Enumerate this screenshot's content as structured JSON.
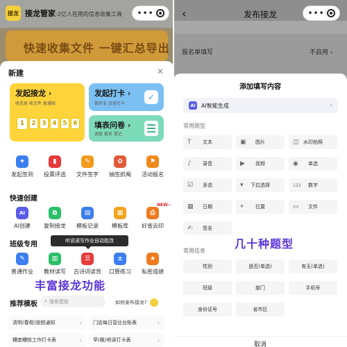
{
  "left": {
    "app_logo": "接龙",
    "app_title": "接龙管家",
    "app_subtitle": "-2亿人在用的信息收集工具",
    "banner_text": "快速收集文件  一键汇总导出",
    "sheet_title": "新建",
    "close_icon": "close-icon",
    "cards": {
      "relay": {
        "title": "发起接龙",
        "sub": "收信息 收文件 发通知",
        "nums": [
          "1",
          "2",
          "3",
          "4",
          "5",
          "6"
        ]
      },
      "checkin": {
        "title": "发起打卡",
        "sub": "做作业 日常打卡"
      },
      "form": {
        "title": "填表问卷",
        "sub": "调查 报名 登记"
      }
    },
    "row1": [
      "发起签到",
      "投票评选",
      "文件签字",
      "抽签抓阄",
      "活动报名"
    ],
    "quick_title": "快速创建",
    "quick": [
      "AI创建",
      "复制接龙",
      "模板记录",
      "模板库",
      "好省云印"
    ],
    "new_badge": "NEW~",
    "class_title": "班级专用",
    "tooltip": "听说读写作业自动批改",
    "class_items": [
      "普通作业",
      "教材读写",
      "古诗词读背",
      "口算练习",
      "私密成绩"
    ],
    "overlay": "丰富接龙功能",
    "rec_title": "推荐模板",
    "rec_search_placeholder": "搜索模板",
    "rec_link": "如何发布接龙?",
    "rec_items": [
      "清明(春假)放假通知",
      "门店每日营业台账表",
      "糟查糟核工作打卡表",
      "早(晚)喷读打卡表"
    ]
  },
  "right": {
    "page_title": "发布接龙",
    "bg_row_label": "报名单填写",
    "bg_row_value": "不启用",
    "sheet_title": "添加填写内容",
    "ai_badge": "AI",
    "ai_label": "AI智能生成",
    "common_types_title": "常用题型",
    "types": [
      {
        "label": "文本",
        "icon": "text-icon"
      },
      {
        "label": "图片",
        "icon": "image-icon"
      },
      {
        "label": "水印拍照",
        "icon": "camera-icon"
      },
      {
        "label": "录音",
        "icon": "mic-icon"
      },
      {
        "label": "视频",
        "icon": "video-icon"
      },
      {
        "label": "单选",
        "icon": "radio-icon"
      },
      {
        "label": "多选",
        "icon": "checkbox-icon"
      },
      {
        "label": "下拉选择",
        "icon": "dropdown-icon"
      },
      {
        "label": "数字",
        "icon": "number-icon"
      },
      {
        "label": "日期",
        "icon": "calendar-icon"
      },
      {
        "label": "位置",
        "icon": "location-icon"
      },
      {
        "label": "文件",
        "icon": "file-icon"
      },
      {
        "label": "签名",
        "icon": "sign-icon"
      }
    ],
    "common_info_title": "常用信息",
    "info": [
      "性别",
      "是否(单选)",
      "有无(单选)",
      "班级",
      "部门",
      "手机号",
      "身份证号",
      "省市区"
    ],
    "overlay": "几十种题型",
    "cancel": "取消"
  },
  "colors": {
    "accent_purple": "#5a36d8",
    "yellow_card": "#ffd43b",
    "blue_card": "#7cc0f3",
    "green_card": "#7edbb9"
  }
}
